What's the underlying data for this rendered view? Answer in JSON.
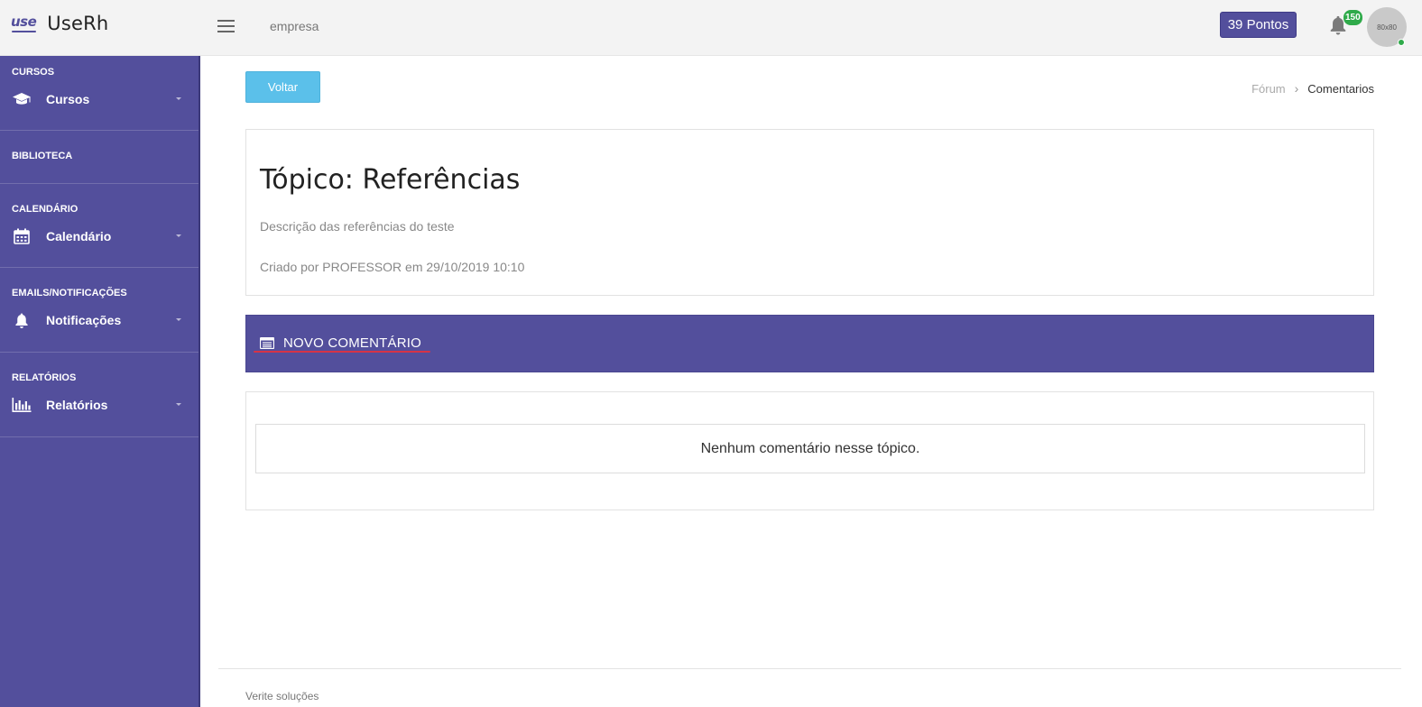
{
  "brand": {
    "mark": "use",
    "name": "UseRh",
    "accent": "#534f9c"
  },
  "topbar": {
    "company": "empresa",
    "points_label": "39 Pontos",
    "notification_count": "150",
    "avatar_text": "80x80"
  },
  "sidebar": {
    "sections": [
      {
        "heading": "CURSOS",
        "item": {
          "label": "Cursos",
          "icon": "graduation-cap-icon"
        }
      },
      {
        "heading": "BIBLIOTECA"
      },
      {
        "heading": "CALENDÁRIO",
        "item": {
          "label": "Calendário",
          "icon": "calendar-icon"
        }
      },
      {
        "heading": "EMAILS/NOTIFICAÇÕES",
        "item": {
          "label": "Notificações",
          "icon": "bell-icon"
        }
      },
      {
        "heading": "RELATÓRIOS",
        "item": {
          "label": "Relatórios",
          "icon": "bar-chart-icon"
        }
      }
    ]
  },
  "main": {
    "back_button": "Voltar",
    "breadcrumb": {
      "parent": "Fórum",
      "current": "Comentarios"
    },
    "topic": {
      "title": "Tópico: Referências",
      "description": "Descrição das referências do teste",
      "meta": "Criado por PROFESSOR em 29/10/2019 10:10"
    },
    "new_comment_label": "NOVO COMENTÁRIO",
    "empty_comments": "Nenhum comentário nesse tópico."
  },
  "footer": {
    "text": "Verite soluções"
  }
}
